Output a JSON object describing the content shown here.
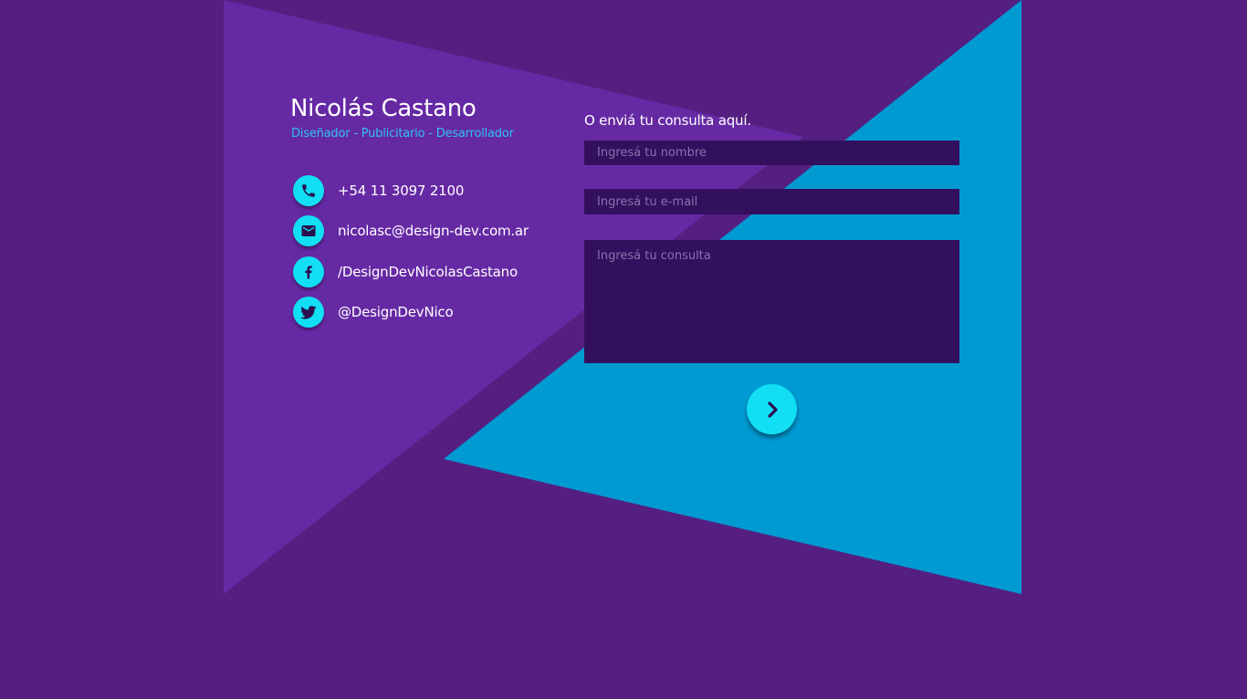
{
  "colors": {
    "background": "#541f80",
    "left_triangle": "#6629a4",
    "right_triangle": "#009ad3",
    "accent": "#12def4",
    "field_background": "#33105d",
    "subtitle": "#2fc0f4"
  },
  "profile": {
    "name": "Nicolás Castano",
    "subtitle": "Diseñador - Publicitario - Desarrollador"
  },
  "contacts": [
    {
      "icon": "phone-icon",
      "text": "+54 11 3097 2100"
    },
    {
      "icon": "mail-icon",
      "text": "nicolasc@design-dev.com.ar"
    },
    {
      "icon": "facebook-icon",
      "text": "/DesignDevNicolasCastano"
    },
    {
      "icon": "twitter-icon",
      "text": "@DesignDevNico"
    }
  ],
  "form": {
    "label": "O enviá tu consulta aquí.",
    "name_placeholder": "Ingresá tu nombre",
    "email_placeholder": "Ingresá tu e-mail",
    "message_placeholder": "Ingresá tu consulta",
    "submit_icon": "chevron-right-icon"
  }
}
